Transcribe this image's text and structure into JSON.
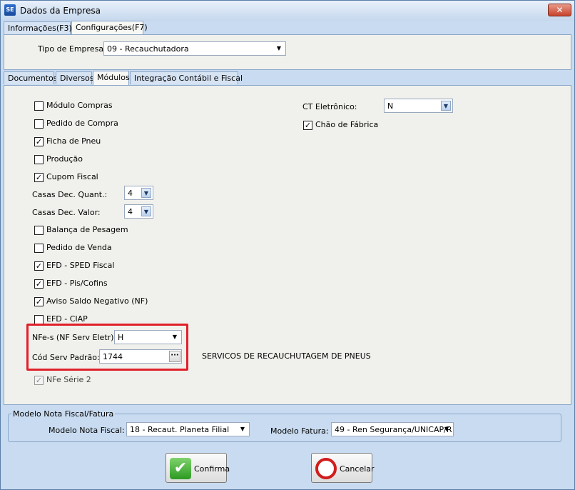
{
  "window": {
    "title": "Dados da Empresa",
    "icon_text": "SE",
    "close_symbol": "✕"
  },
  "top_tabs": [
    {
      "label": "Informações(F3)"
    },
    {
      "label": "Configurações(F7)"
    }
  ],
  "tipo_empresa": {
    "label": "Tipo de Empresa:",
    "value": "09 - Recauchutadora"
  },
  "sub_tabs": [
    {
      "label": "Documentos"
    },
    {
      "label": "Diversos"
    },
    {
      "label": "Módulos"
    },
    {
      "label": "Integração Contábil e Fiscal"
    }
  ],
  "modulos": {
    "modulo_compras": {
      "label": "Módulo Compras",
      "checked": false
    },
    "pedido_compra": {
      "label": "Pedido de Compra",
      "checked": false
    },
    "ficha_pneu": {
      "label": "Ficha de Pneu",
      "checked": true
    },
    "producao": {
      "label": "Produção",
      "checked": false
    },
    "cupom_fiscal": {
      "label": "Cupom Fiscal",
      "checked": true
    },
    "casas_quant": {
      "label": "Casas Dec. Quant.:",
      "value": "4"
    },
    "casas_valor": {
      "label": "Casas Dec. Valor:",
      "value": "4"
    },
    "balanca": {
      "label": "Balança de Pesagem",
      "checked": false
    },
    "pedido_venda": {
      "label": "Pedido de Venda",
      "checked": false
    },
    "efd_sped": {
      "label": "EFD - SPED Fiscal",
      "checked": true
    },
    "efd_pis": {
      "label": "EFD - Pis/Cofins",
      "checked": true
    },
    "aviso_saldo": {
      "label": "Aviso Saldo Negativo (NF)",
      "checked": true
    },
    "efd_ciap": {
      "label": "EFD - CIAP",
      "checked": false
    },
    "nfse": {
      "label": "NFe-s (NF Serv Eletr):",
      "value": "H"
    },
    "cod_serv": {
      "label": "Cód Serv Padrão:",
      "value": "1744",
      "description": "SERVICOS DE RECAUCHUTAGEM DE PNEUS",
      "button": "···"
    },
    "nfe_serie2": {
      "label": "NFe Série 2",
      "checked": true
    }
  },
  "right_column": {
    "ct_eletronico": {
      "label": "CT Eletrônico:",
      "value": "N"
    },
    "chao_fabrica": {
      "label": "Chão de Fábrica",
      "checked": true
    }
  },
  "modelo_group": {
    "title": "Modelo Nota Fiscal/Fatura",
    "nota_fiscal_label": "Modelo Nota Fiscal:",
    "nota_fiscal_value": "18 - Recaut. Planeta Filial",
    "fatura_label": "Modelo Fatura:",
    "fatura_value": "49 - Ren Segurança/UNICAP/R"
  },
  "buttons": {
    "confirma": "Confirma",
    "confirma_icon": "✔",
    "cancelar": "Cancelar",
    "cancelar_icon": "⃠"
  },
  "arrow_symbol": "▼",
  "check_symbol": "✓"
}
